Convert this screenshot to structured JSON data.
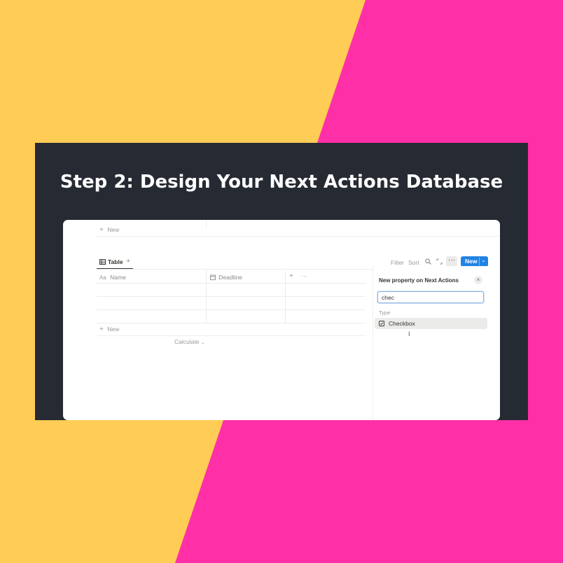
{
  "heading": "Step 2: Design Your Next Actions Database",
  "colors": {
    "yellow": "#ffcc55",
    "pink": "#ff2fa7",
    "banner": "#262a33",
    "accent": "#2383e2"
  },
  "top_row": {
    "new_label": "New"
  },
  "view": {
    "tab_label": "Table",
    "add_view_icon": "plus-icon"
  },
  "toolbar": {
    "filter": "Filter",
    "sort": "Sort",
    "search_icon": "search-icon",
    "expand_icon": "expand-icon",
    "more_icon": "more-icon",
    "new_button": "New",
    "new_chevron": "chevron-down-icon"
  },
  "table": {
    "columns": [
      {
        "label": "Name",
        "icon": "text-icon"
      },
      {
        "label": "Deadline",
        "icon": "calendar-icon"
      }
    ],
    "row_count": 3,
    "new_row": "New",
    "calculate": "Calculate"
  },
  "property_panel": {
    "title": "New property on Next Actions",
    "search_value": "chec",
    "section_label": "Type",
    "options": [
      {
        "label": "Checkbox",
        "icon": "checkbox-icon"
      }
    ]
  }
}
